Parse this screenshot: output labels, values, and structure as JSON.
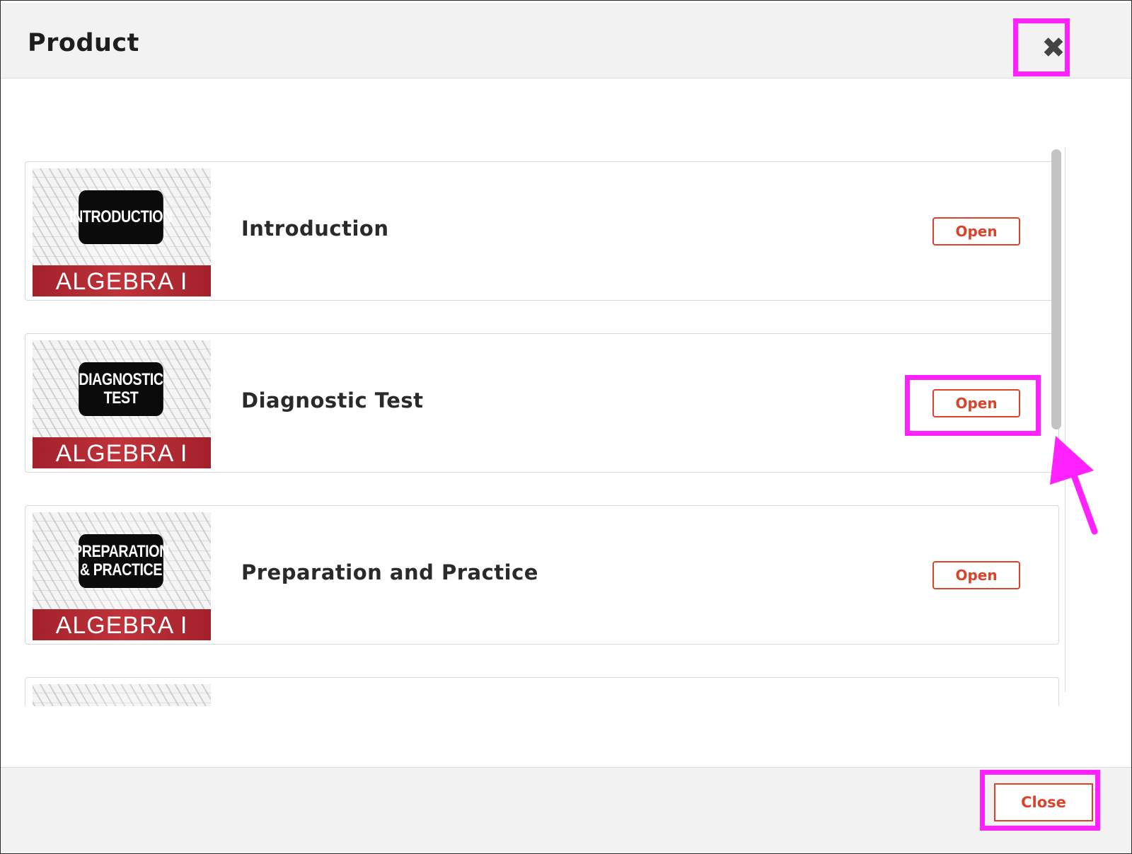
{
  "dialog": {
    "title": "Product",
    "close_icon_glyph": "✖",
    "footer": {
      "close_label": "Close"
    }
  },
  "items": [
    {
      "badge": "INTRODUCTION",
      "band": "ALGEBRA I",
      "title": "Introduction",
      "button": "Open"
    },
    {
      "badge": "DIAGNOSTIC\nTEST",
      "band": "ALGEBRA I",
      "title": "Diagnostic Test",
      "button": "Open"
    },
    {
      "badge": "PREPARATION\n& PRACTICE",
      "band": "ALGEBRA I",
      "title": "Preparation and Practice",
      "button": "Open"
    }
  ],
  "colors": {
    "accent": "#d9432b",
    "highlight": "#ff22ff",
    "header_bg": "#f2f2f2",
    "band_red": "#b22a33"
  }
}
